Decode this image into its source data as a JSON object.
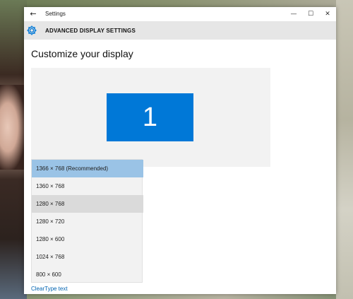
{
  "window": {
    "title": "Settings",
    "back": "←",
    "minimize": "—",
    "maximize": "☐",
    "close": "✕"
  },
  "header": {
    "icon": "gear-icon",
    "title": "ADVANCED DISPLAY SETTINGS"
  },
  "main": {
    "section_title": "Customize your display",
    "display_number": "1",
    "monitor_color": "#0078d7",
    "resolution_options": [
      "1366 × 768 (Recommended)",
      "1360 × 768",
      "1280 × 768",
      "1280 × 720",
      "1280 × 600",
      "1024 × 768",
      "800 × 600"
    ],
    "selected_index": 0,
    "hovered_index": 2,
    "cleartype_link": "ClearType text"
  },
  "colors": {
    "accent": "#0078d7",
    "selected_item": "#9ac3e6",
    "link": "#0063b1"
  }
}
